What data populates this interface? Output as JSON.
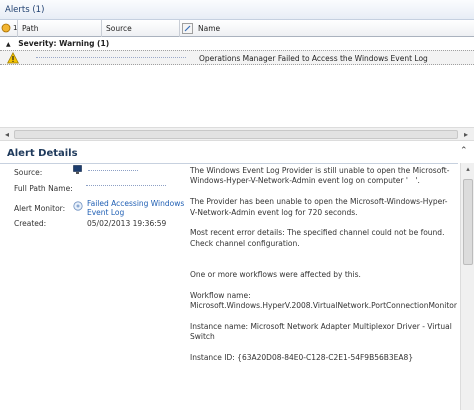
{
  "alerts_pane": {
    "title": "Alerts (1)",
    "columns": {
      "sort_count": "1",
      "path": "Path",
      "source": "Source",
      "name": "Name"
    },
    "group": {
      "toggle": "▲",
      "label": "Severity: Warning (1)"
    },
    "rows": [
      {
        "severity_icon": "warning-icon",
        "name": "Operations Manager Failed to Access the Windows Event Log"
      }
    ]
  },
  "details": {
    "title": "Alert Details",
    "collapse": "⌃",
    "fields": {
      "source_label": "Source:",
      "full_path_label": "Full Path Name:",
      "monitor_label": "Alert Monitor:",
      "monitor_value_line1": "Failed Accessing Windows",
      "monitor_value_line2": "Event Log",
      "created_label": "Created:",
      "created_value": "05/02/2013 19:36:59"
    },
    "description": {
      "p1": "The Windows Event Log Provider is still unable to open the Microsoft-Windows-Hyper-V-Network-Admin event log on computer '     '.",
      "p2": "The Provider has been unable to open the Microsoft-Windows-Hyper-V-Network-Admin event log for 720 seconds.",
      "p3": "Most recent error details: The specified channel could not be found. Check channel configuration.",
      "p4": "One or more workflows were affected by this.",
      "p5_label": "Workflow name:",
      "p5_value": "Microsoft.Windows.HyperV.2008.VirtualNetwork.PortConnectionMonitor",
      "p6_label": "Instance name: Microsoft Network Adapter Multiplexor Driver - Virtual Switch",
      "p7_label": "Instance ID: {63A20D08-84E0-C128-C2E1-54F9B56B3EA8}"
    }
  },
  "colors": {
    "accent": "#1f5fb4",
    "title": "#1e395b",
    "warning": "#f5c400"
  }
}
